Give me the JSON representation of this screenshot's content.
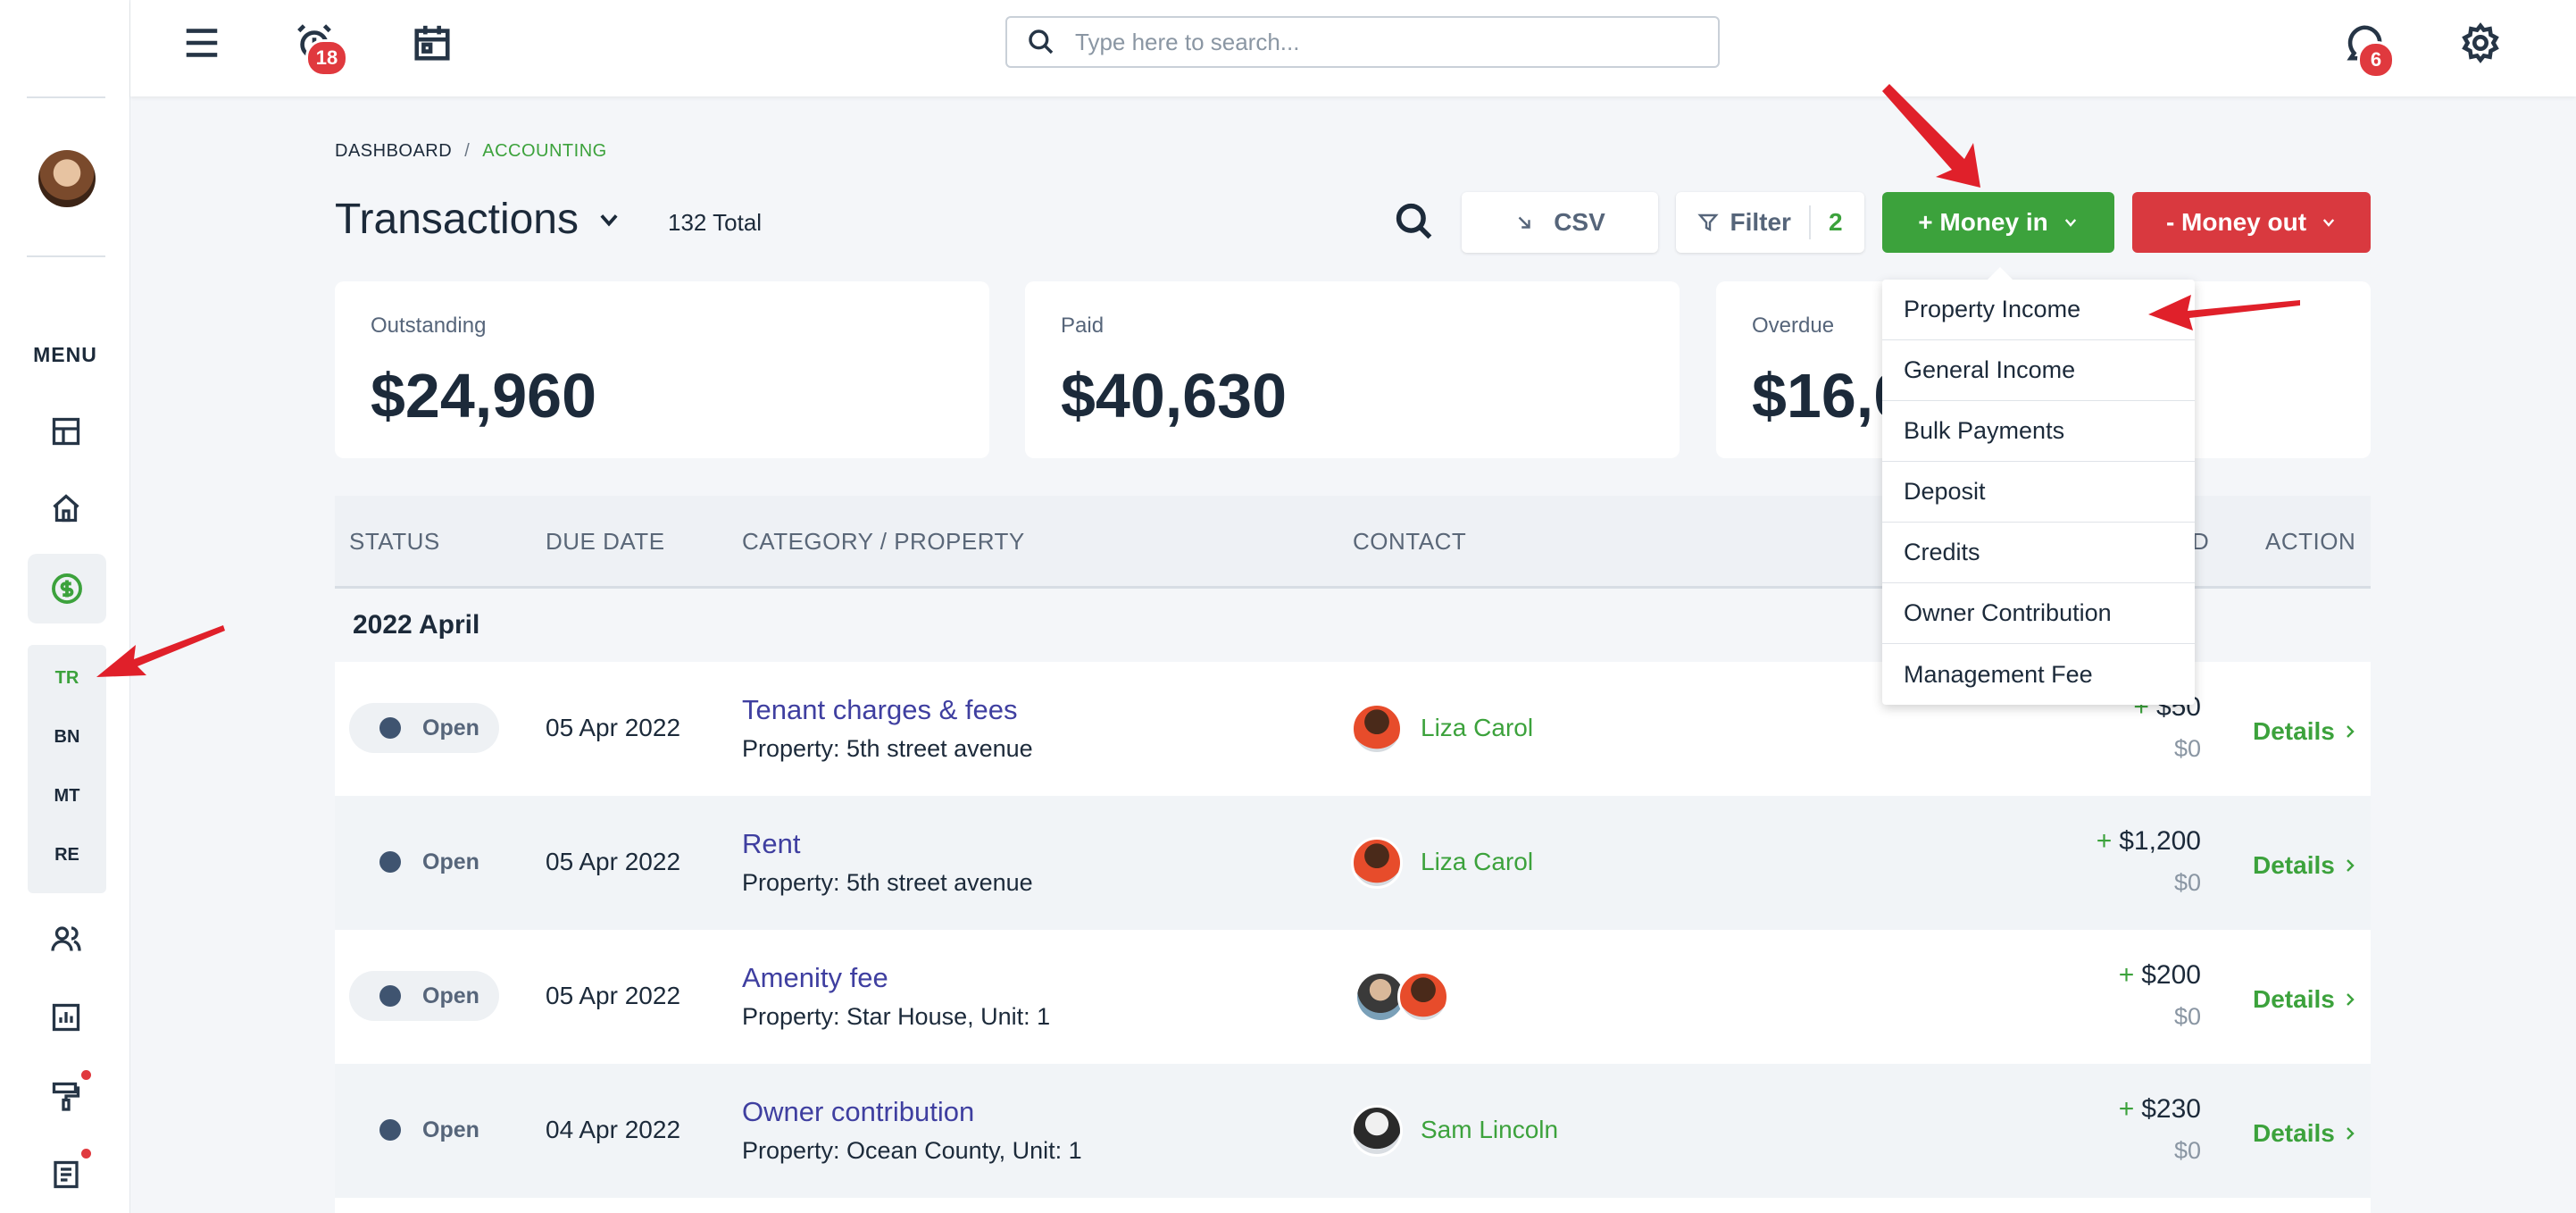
{
  "topbar": {
    "notifications_count": "18",
    "messages_count": "6",
    "search_placeholder": "Type here to search..."
  },
  "sidebar": {
    "menu_label": "MENU",
    "sub_items": [
      "TR",
      "BN",
      "MT",
      "RE"
    ]
  },
  "breadcrumb": {
    "root": "DASHBOARD",
    "separator": "/",
    "current": "ACCOUNTING"
  },
  "page": {
    "title": "Transactions",
    "total": "132 Total"
  },
  "toolbar": {
    "csv_label": "CSV",
    "filter_label": "Filter",
    "filter_count": "2",
    "money_in_label": "+ Money in",
    "money_out_label": "- Money out"
  },
  "cards": {
    "outstanding": {
      "label": "Outstanding",
      "value": "$24,960"
    },
    "paid": {
      "label": "Paid",
      "value": "$40,630"
    },
    "overdue": {
      "label": "Overdue",
      "value": "$16,0"
    }
  },
  "money_in_menu": [
    "Property Income",
    "General Income",
    "Bulk Payments",
    "Deposit",
    "Credits",
    "Owner Contribution",
    "Management Fee"
  ],
  "table": {
    "headers": {
      "status": "STATUS",
      "due_date": "DUE DATE",
      "category": "CATEGORY / PROPERTY",
      "contact": "CONTACT",
      "amount_partial": "D",
      "action": "ACTION"
    },
    "group_label": "2022 April",
    "rows": [
      {
        "status": "Open",
        "due": "05 Apr 2022",
        "category": "Tenant charges & fees",
        "property": "Property: 5th street avenue",
        "contact": "Liza Carol",
        "amount_sign": "+",
        "amount": "$50",
        "paid": "$0",
        "action": "Details"
      },
      {
        "status": "Open",
        "due": "05 Apr 2022",
        "category": "Rent",
        "property": "Property: 5th street avenue",
        "contact": "Liza Carol",
        "amount_sign": "+",
        "amount": "$1,200",
        "paid": "$0",
        "action": "Details"
      },
      {
        "status": "Open",
        "due": "05 Apr 2022",
        "category": "Amenity fee",
        "property": "Property: Star House, Unit: 1",
        "contact": "",
        "amount_sign": "+",
        "amount": "$200",
        "paid": "$0",
        "action": "Details"
      },
      {
        "status": "Open",
        "due": "04 Apr 2022",
        "category": "Owner contribution",
        "property": "Property: Ocean County, Unit: 1",
        "contact": "Sam Lincoln",
        "amount_sign": "+",
        "amount": "$230",
        "paid": "$0",
        "action": "Details"
      }
    ]
  },
  "colors": {
    "accent_green": "#3ca23c",
    "danger_red": "#d9393f",
    "link_purple": "#3f3fa0"
  }
}
